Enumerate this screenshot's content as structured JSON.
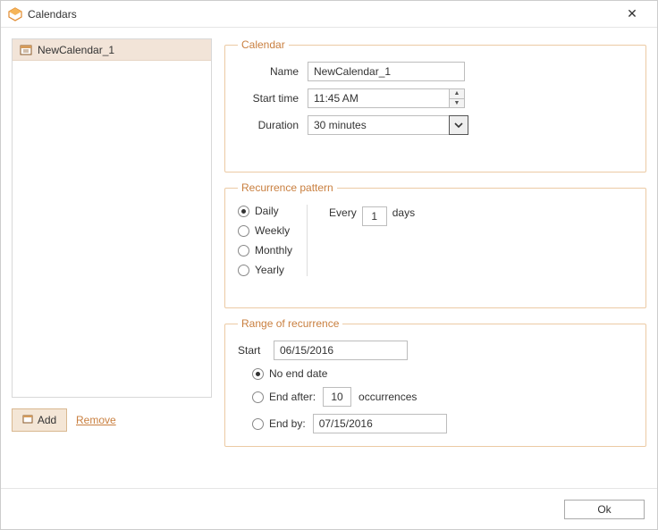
{
  "window": {
    "title": "Calendars",
    "close_glyph": "✕"
  },
  "sidebar": {
    "items": [
      {
        "label": "NewCalendar_1"
      }
    ],
    "add_label": "Add",
    "remove_label": "Remove"
  },
  "calendar_group": {
    "legend": "Calendar",
    "name_label": "Name",
    "name_value": "NewCalendar_1",
    "start_label": "Start time",
    "start_value": "11:45 AM",
    "duration_label": "Duration",
    "duration_value": "30 minutes"
  },
  "recur_group": {
    "legend": "Recurrence pattern",
    "options": {
      "daily": "Daily",
      "weekly": "Weekly",
      "monthly": "Monthly",
      "yearly": "Yearly"
    },
    "selected": "daily",
    "every_label": "Every",
    "every_value": "1",
    "days_label": "days"
  },
  "range_group": {
    "legend": "Range of recurrence",
    "start_label": "Start",
    "start_value": "06/15/2016",
    "no_end_label": "No end date",
    "end_after_label": "End after:",
    "end_after_value": "10",
    "occurrences_label": "occurrences",
    "end_by_label": "End by:",
    "end_by_value": "07/15/2016",
    "selected": "no_end"
  },
  "footer": {
    "ok_label": "Ok"
  }
}
